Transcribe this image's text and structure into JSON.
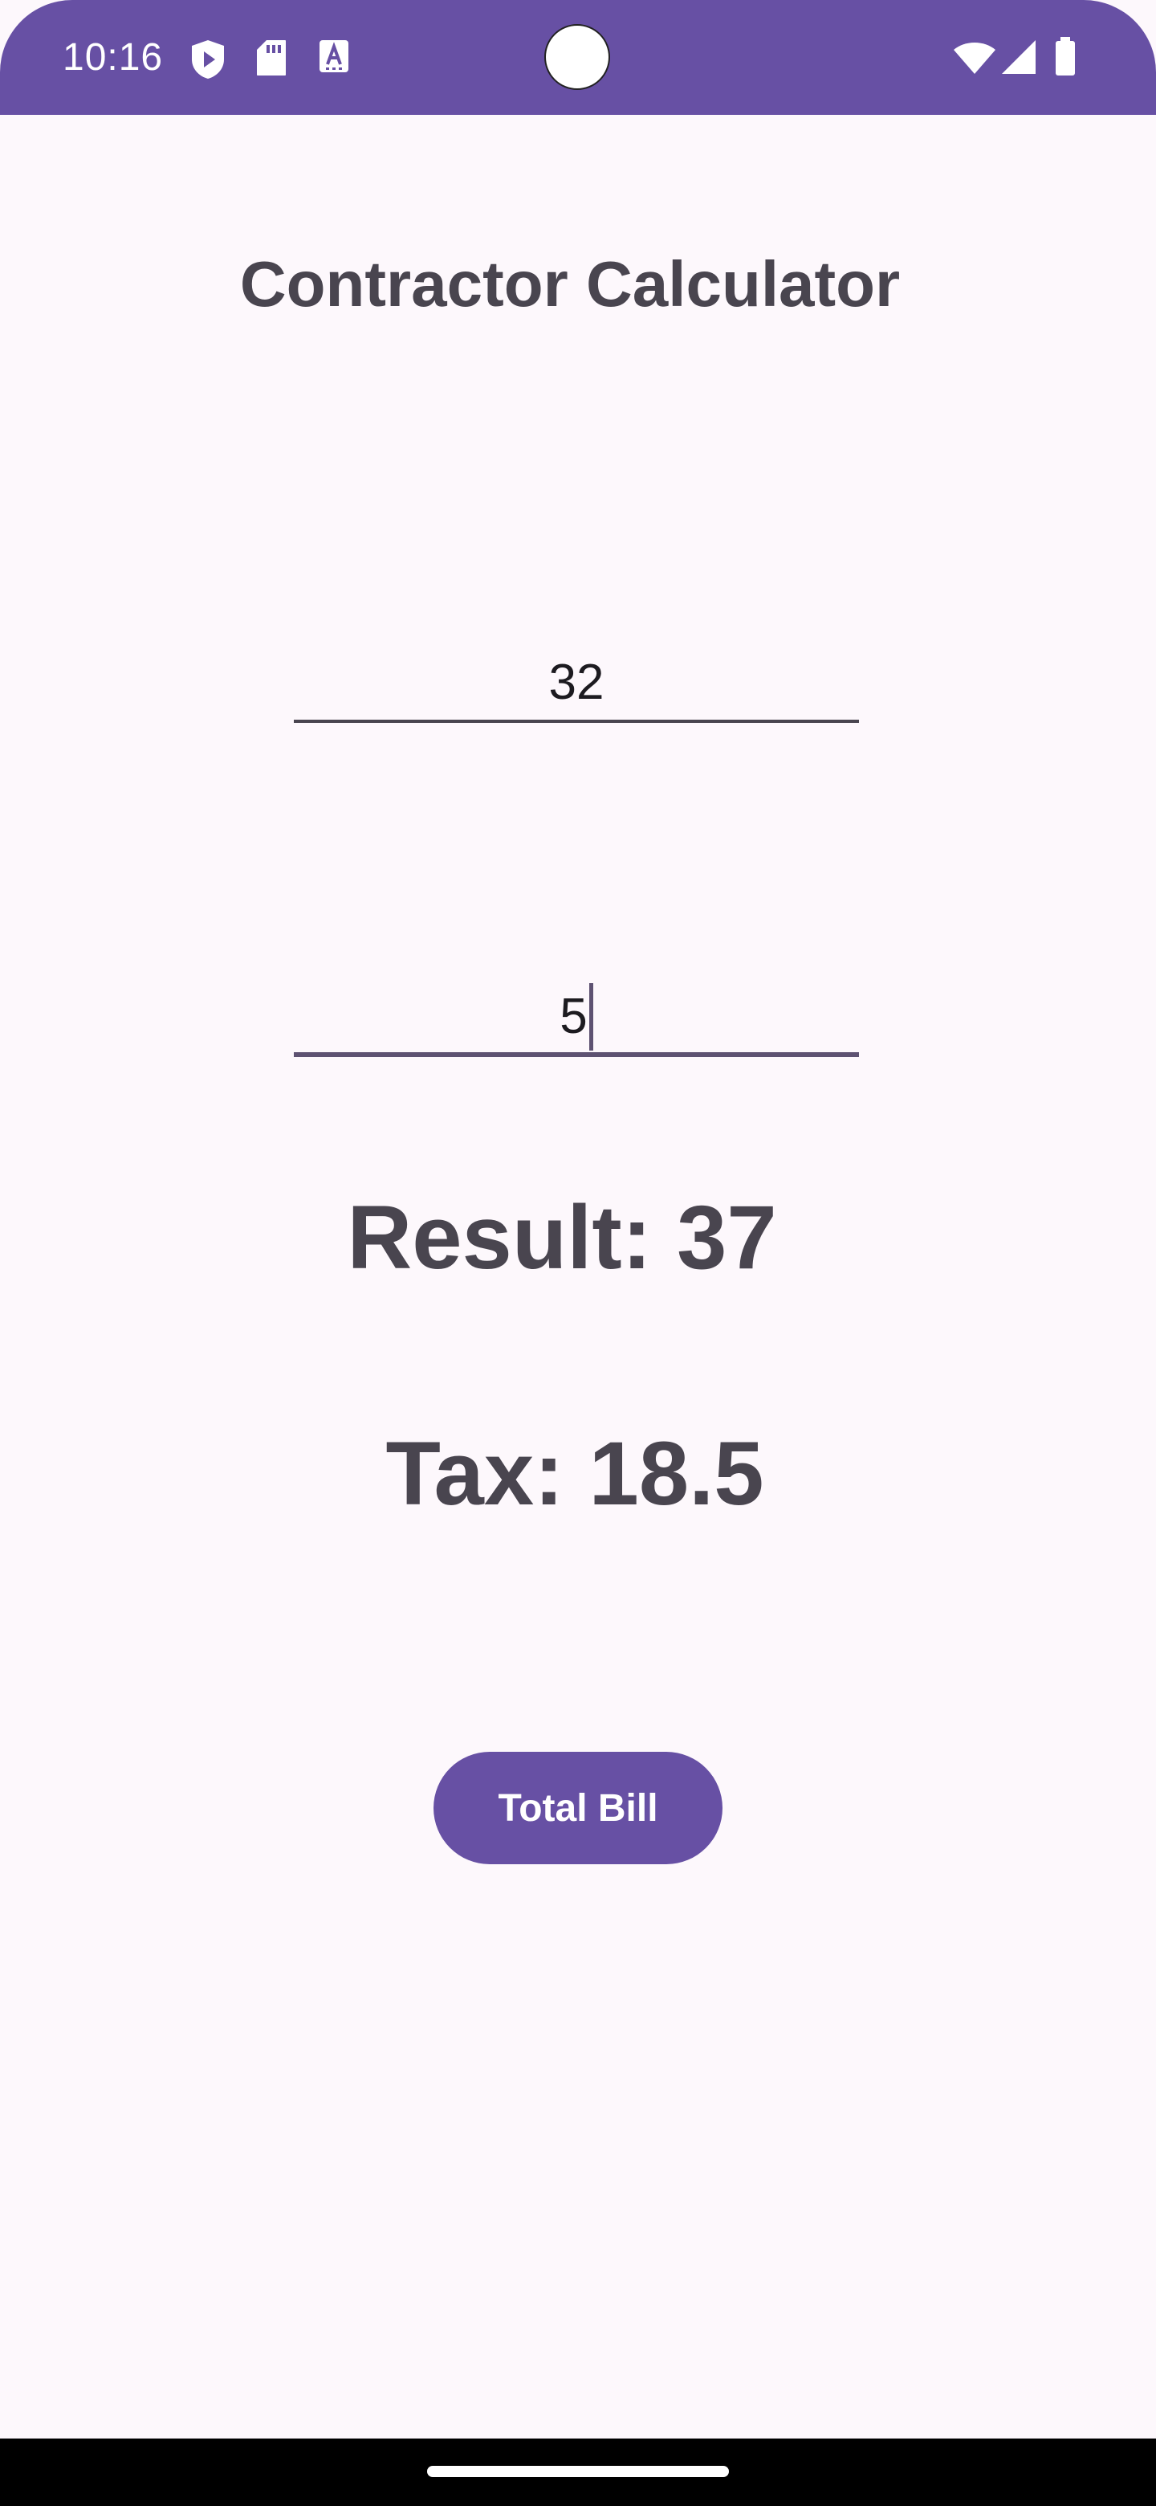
{
  "status_bar": {
    "time": "10:16",
    "background_color": "#6750a4",
    "left_icons": [
      "play-protect-icon",
      "sd-card-icon",
      "font-a-icon"
    ],
    "right_icons": [
      "wifi-icon",
      "signal-icon",
      "battery-icon"
    ]
  },
  "app": {
    "title": "Contractor Calculator",
    "first_input_value": "32",
    "second_input_value": "5",
    "result_text": "Result: 37",
    "tax_text": "Tax: 18.5",
    "total_button_label": "Total Bill",
    "accent_color": "#6750a4",
    "text_color": "#49454f"
  }
}
